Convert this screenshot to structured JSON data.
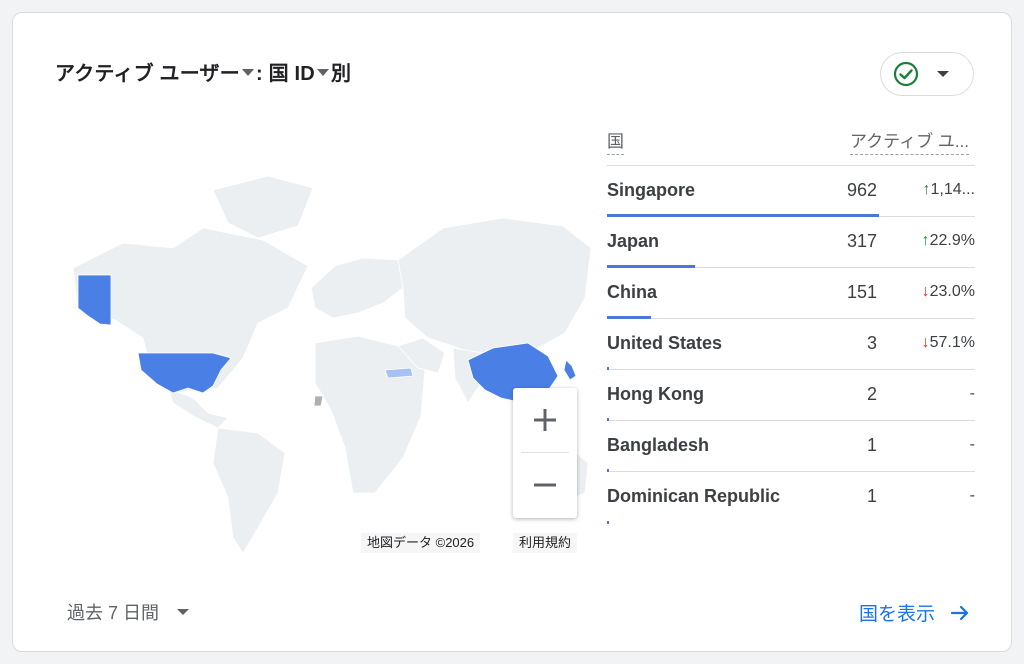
{
  "card": {
    "title_part1": "アクティブ ユーザー",
    "title_part2": ": 国 ID",
    "title_part3": "別"
  },
  "map": {
    "attribution": "地図データ ©2026",
    "terms": "利用規約",
    "zoom_in": "+",
    "zoom_out": "−",
    "colors": {
      "high": "#4a7fe6",
      "low": "#a7c1f2",
      "base": "#eceff1",
      "noData": "#b0b0b0"
    }
  },
  "table": {
    "col_country": "国",
    "col_active": "アクティブ ユ...",
    "rows": [
      {
        "country": "Singapore",
        "value": "962",
        "change": "1,14...",
        "direction": "up",
        "share": 0.74
      },
      {
        "country": "Japan",
        "value": "317",
        "change": "22.9%",
        "direction": "up",
        "share": 0.24
      },
      {
        "country": "China",
        "value": "151",
        "change": "23.0%",
        "direction": "down",
        "share": 0.12
      },
      {
        "country": "United States",
        "value": "3",
        "change": "57.1%",
        "direction": "down",
        "share": 0.005
      },
      {
        "country": "Hong Kong",
        "value": "2",
        "change": "-",
        "direction": "none",
        "share": 0.004
      },
      {
        "country": "Bangladesh",
        "value": "1",
        "change": "-",
        "direction": "none",
        "share": 0.003
      },
      {
        "country": "Dominican Republic",
        "value": "1",
        "change": "-",
        "direction": "none",
        "share": 0.003
      }
    ]
  },
  "footer": {
    "date_range": "過去 7 日間",
    "view_link": "国を表示"
  },
  "icons": {
    "compare": "check-circle-icon",
    "arrow": "arrow-right-icon"
  }
}
